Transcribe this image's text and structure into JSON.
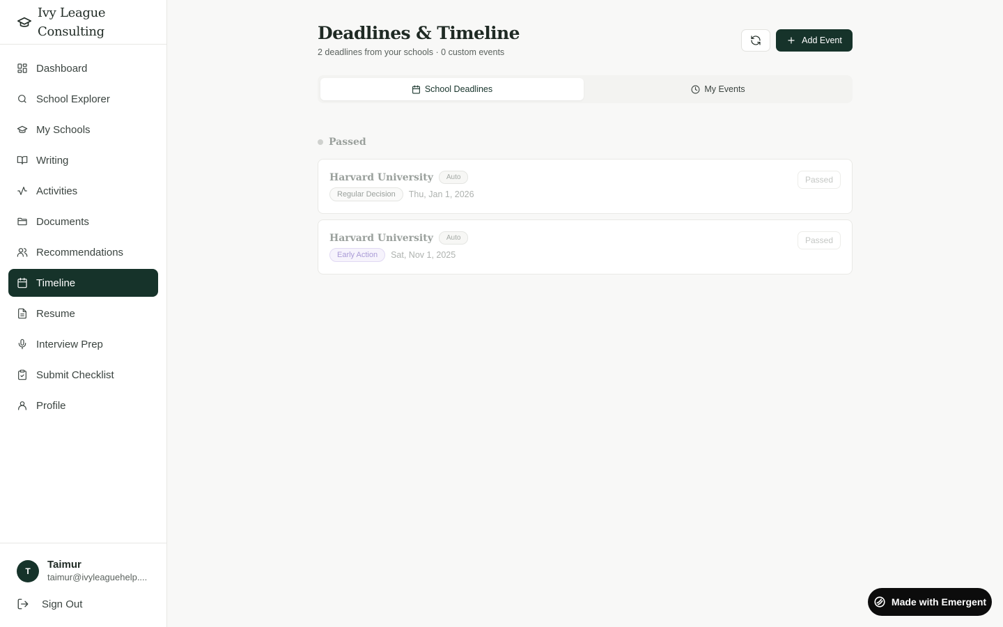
{
  "sidebar": {
    "brand": "Ivy League Consulting",
    "items": [
      {
        "label": "Dashboard",
        "icon": "dashboard-icon"
      },
      {
        "label": "School Explorer",
        "icon": "search-icon"
      },
      {
        "label": "My Schools",
        "icon": "graduation-cap-icon"
      },
      {
        "label": "Writing",
        "icon": "book-icon"
      },
      {
        "label": "Activities",
        "icon": "activity-icon"
      },
      {
        "label": "Documents",
        "icon": "folder-icon"
      },
      {
        "label": "Recommendations",
        "icon": "users-icon"
      },
      {
        "label": "Timeline",
        "icon": "calendar-icon",
        "active": true
      },
      {
        "label": "Resume",
        "icon": "file-icon"
      },
      {
        "label": "Interview Prep",
        "icon": "mic-icon"
      },
      {
        "label": "Submit Checklist",
        "icon": "clipboard-icon"
      },
      {
        "label": "Profile",
        "icon": "user-icon"
      }
    ],
    "user": {
      "initial": "T",
      "name": "Taimur",
      "email": "taimur@ivyleaguehelp...."
    },
    "sign_out": "Sign Out"
  },
  "header": {
    "title": "Deadlines & Timeline",
    "subtitle": "2 deadlines from your schools · 0 custom events",
    "add_event": "Add Event"
  },
  "tabs": [
    {
      "label": "School Deadlines",
      "icon": "calendar-icon",
      "active": true
    },
    {
      "label": "My Events",
      "icon": "clock-icon"
    }
  ],
  "section": {
    "label": "Passed"
  },
  "deadlines": [
    {
      "school": "Harvard University",
      "badge": "Auto",
      "type": "Regular Decision",
      "date": "Thu, Jan 1, 2026",
      "status": "Passed"
    },
    {
      "school": "Harvard University",
      "badge": "Auto",
      "type": "Early Action",
      "date": "Sat, Nov 1, 2025",
      "status": "Passed"
    }
  ],
  "footer": {
    "made_with": "Made with Emergent"
  },
  "colors": {
    "accent": "#16332a",
    "background": "#f8f8f7",
    "early_action": "#a99ad6"
  }
}
